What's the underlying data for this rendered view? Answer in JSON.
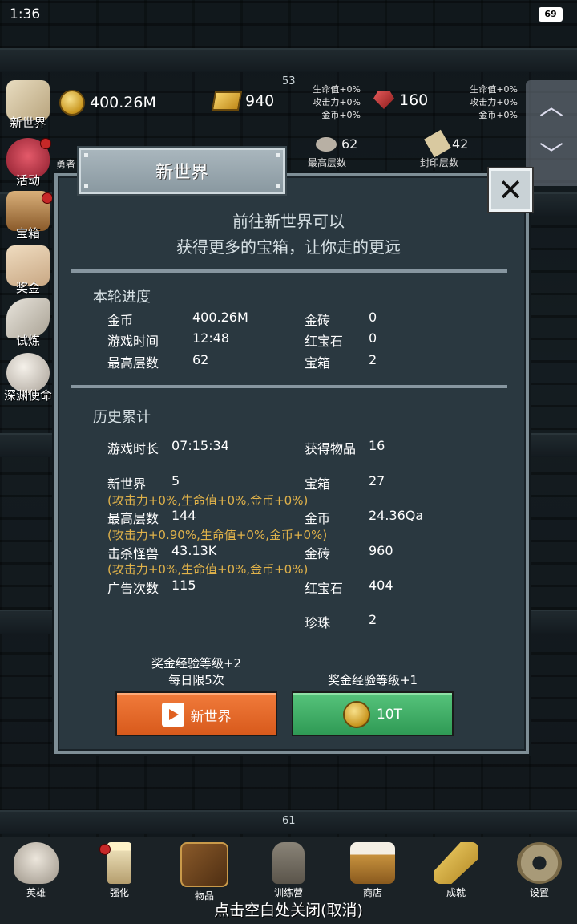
{
  "status": {
    "time": "1:36",
    "battery": "69"
  },
  "resources": {
    "gold": "400.26M",
    "gold_brick": "940",
    "ruby": "160",
    "floor_top": "53",
    "stats_left": [
      "生命值+0%",
      "攻击力+0%",
      "金币+0%"
    ],
    "stats_right": [
      "生命值+0%",
      "攻击力+0%",
      "金币+0%"
    ],
    "stones": "62",
    "scrolls": "42",
    "hero_label": "勇者",
    "max_floor_label": "最高层数",
    "sealed_floor_label": "封印层数"
  },
  "left_menu": [
    {
      "label": "新世界",
      "icon": "map-icon"
    },
    {
      "label": "活动",
      "icon": "heart-icon"
    },
    {
      "label": "宝箱",
      "icon": "chest-icon"
    },
    {
      "label": "奖金",
      "icon": "envelope-icon"
    },
    {
      "label": "试炼",
      "icon": "feather-icon"
    },
    {
      "label": "深渊使命",
      "icon": "pearl-icon"
    }
  ],
  "dialog": {
    "title": "新世界",
    "intro_line1": "前往新世界可以",
    "intro_line2": "获得更多的宝箱，让你走的更远",
    "round": {
      "title": "本轮进度",
      "rows": [
        {
          "k1": "金币",
          "v1": "400.26M",
          "k2": "金砖",
          "v2": "0"
        },
        {
          "k1": "游戏时间",
          "v1": "12:48",
          "k2": "红宝石",
          "v2": "0"
        },
        {
          "k1": "最高层数",
          "v1": "62",
          "k2": "宝箱",
          "v2": "2"
        }
      ]
    },
    "history": {
      "title": "历史累计",
      "play_time_label": "游戏时长",
      "play_time": "07:15:34",
      "items_label": "获得物品",
      "items": "16",
      "new_world_label": "新世界",
      "new_world": "5",
      "chest_label": "宝箱",
      "chest": "27",
      "note1": "(攻击力+0%,生命值+0%,金币+0%)",
      "max_floor_label": "最高层数",
      "max_floor": "144",
      "gold_label": "金币",
      "gold": "24.36Qa",
      "note2": "(攻击力+0.90%,生命值+0%,金币+0%)",
      "kills_label": "击杀怪兽",
      "kills": "43.13K",
      "brick_label": "金砖",
      "brick": "960",
      "note3": "(攻击力+0%,生命值+0%,金币+0%)",
      "ads_label": "广告次数",
      "ads": "115",
      "ruby_label": "红宝石",
      "ruby": "404",
      "pearl_label": "珍珠",
      "pearl": "2"
    },
    "left_caption_line1": "奖金经验等级+2",
    "left_caption_line2": "每日限5次",
    "right_caption": "奖金经验等级+1",
    "left_button": "新世界",
    "right_button": "10T"
  },
  "floor_bottom": "61",
  "bottom_nav": [
    {
      "label": "英雄",
      "icon": "skull-icon"
    },
    {
      "label": "强化",
      "icon": "candle-icon"
    },
    {
      "label": "物品",
      "icon": "book-icon"
    },
    {
      "label": "训练营",
      "icon": "lantern-icon"
    },
    {
      "label": "商店",
      "icon": "beer-mug-icon"
    },
    {
      "label": "成就",
      "icon": "key-icon"
    },
    {
      "label": "设置",
      "icon": "gear-icon"
    }
  ],
  "hint": "点击空白处关闭(取消)",
  "colors": {
    "accent_orange": "#e06a2a",
    "accent_green": "#3fae66",
    "note_gold": "#e0b24a",
    "panel": "#2a3840"
  }
}
